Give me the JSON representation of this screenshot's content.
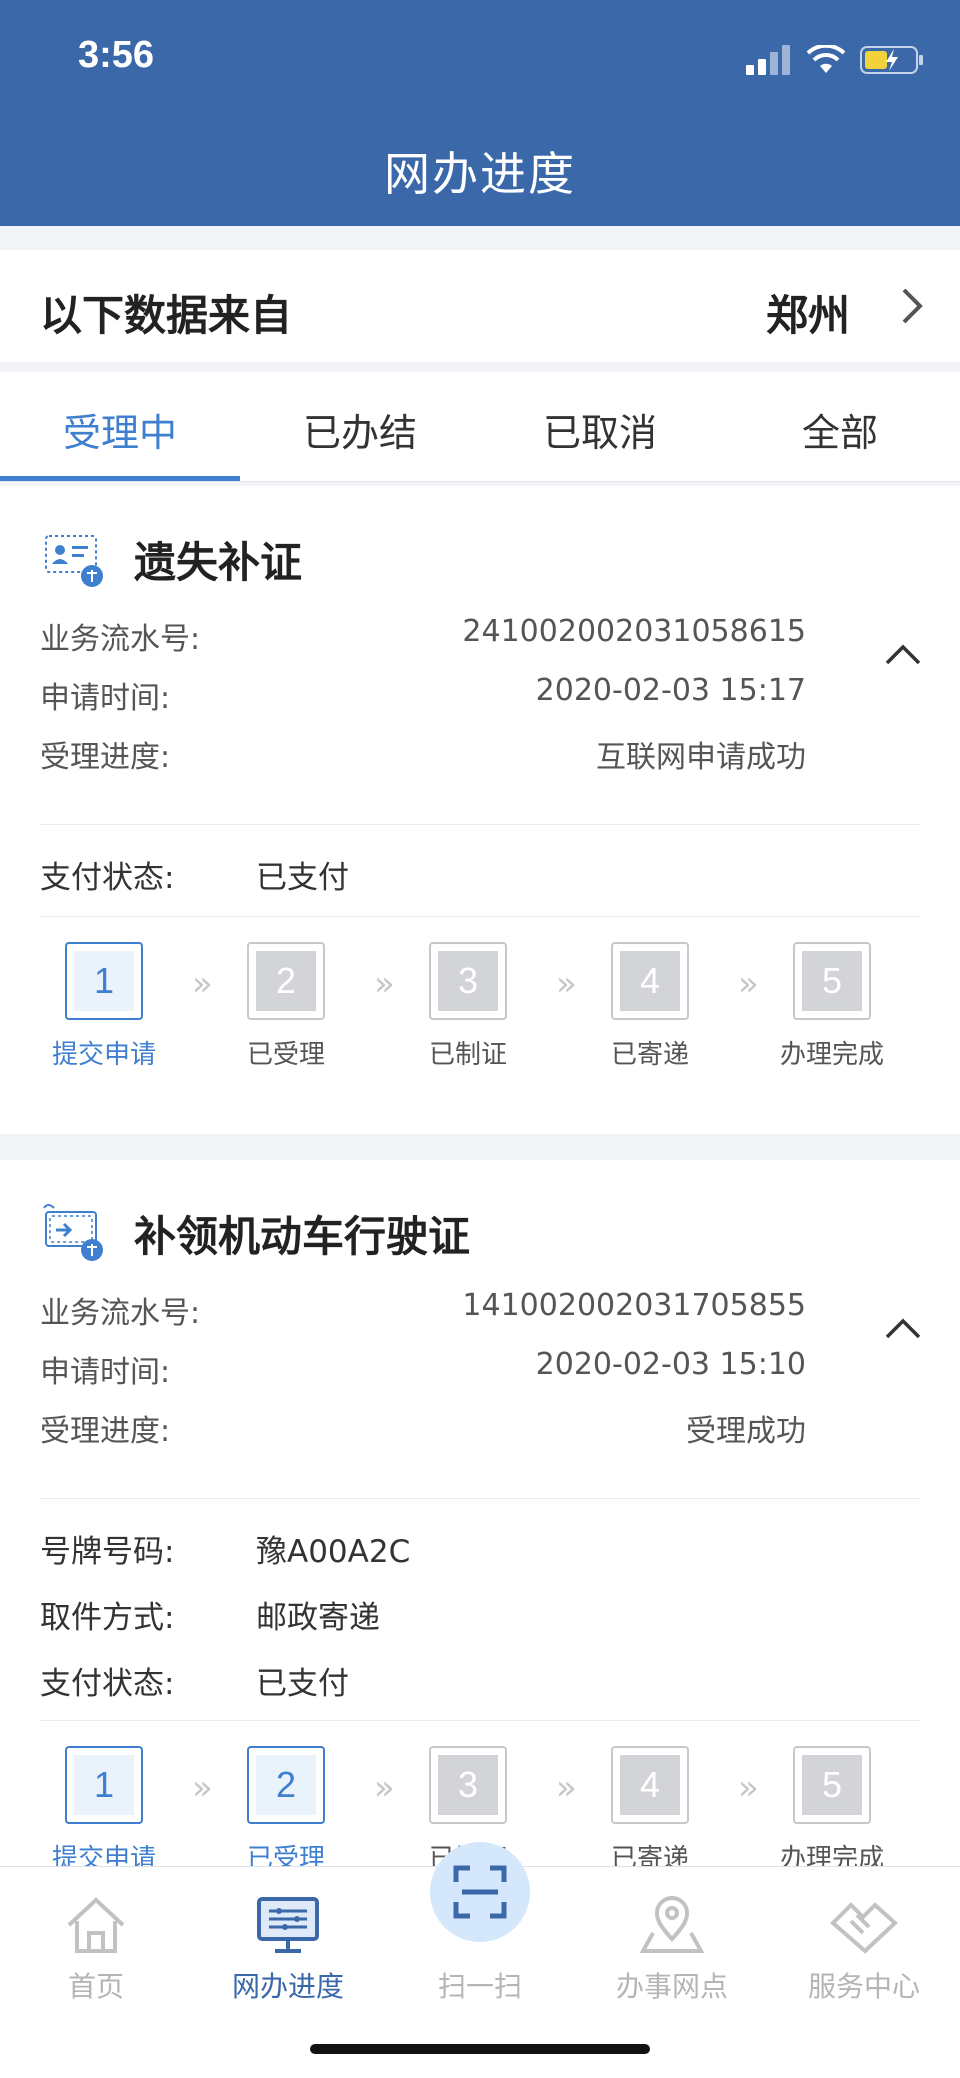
{
  "status": {
    "time": "3:56"
  },
  "nav": {
    "title": "网办进度"
  },
  "source": {
    "label": "以下数据来自",
    "city": "郑州"
  },
  "tabs": [
    {
      "label": "受理中",
      "active": true
    },
    {
      "label": "已办结",
      "active": false
    },
    {
      "label": "已取消",
      "active": false
    },
    {
      "label": "全部",
      "active": false
    }
  ],
  "cards": [
    {
      "title": "遗失补证",
      "serial_key": "业务流水号:",
      "serial": "241002002031058615",
      "time_key": "申请时间:",
      "time": "2020-02-03 15:17",
      "progress_key": "受理进度:",
      "progress": "互联网申请成功",
      "pay_key": "支付状态:",
      "pay": "已支付",
      "steps": [
        {
          "num": "1",
          "label": "提交申请",
          "done": true
        },
        {
          "num": "2",
          "label": "已受理",
          "done": false
        },
        {
          "num": "3",
          "label": "已制证",
          "done": false
        },
        {
          "num": "4",
          "label": "已寄递",
          "done": false
        },
        {
          "num": "5",
          "label": "办理完成",
          "done": false
        }
      ],
      "step_sep": "»"
    },
    {
      "title": "补领机动车行驶证",
      "serial_key": "业务流水号:",
      "serial": "141002002031705855",
      "time_key": "申请时间:",
      "time": "2020-02-03 15:10",
      "progress_key": "受理进度:",
      "progress": "受理成功",
      "plate_key": "号牌号码:",
      "plate": "豫A00A2C",
      "pickup_key": "取件方式:",
      "pickup": "邮政寄递",
      "pay_key": "支付状态:",
      "pay": "已支付",
      "steps": [
        {
          "num": "1",
          "label": "提交申请",
          "done": true
        },
        {
          "num": "2",
          "label": "已受理",
          "done": true
        },
        {
          "num": "3",
          "label": "已制证",
          "done": false
        },
        {
          "num": "4",
          "label": "已寄递",
          "done": false
        },
        {
          "num": "5",
          "label": "办理完成",
          "done": false
        }
      ],
      "step_sep": "»"
    }
  ],
  "tabbar": [
    {
      "label": "首页",
      "icon": "home-icon"
    },
    {
      "label": "网办进度",
      "icon": "monitor-icon",
      "active": true
    },
    {
      "label": "扫一扫",
      "icon": "scan-icon"
    },
    {
      "label": "办事网点",
      "icon": "map-pin-icon"
    },
    {
      "label": "服务中心",
      "icon": "handshake-icon"
    }
  ],
  "colors": {
    "primary": "#3a68a8",
    "accent": "#3f7fd0",
    "inactive": "#d2d4d8"
  }
}
